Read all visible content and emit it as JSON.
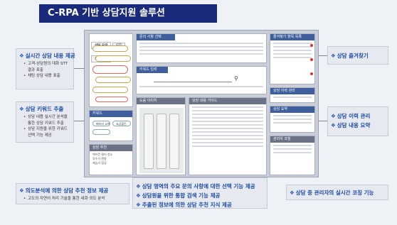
{
  "title": "C-RPA 기반 상담지원 솔루션",
  "callouts": {
    "realtime": {
      "head": "실시간 상담 내용 제공",
      "items": [
        "고객-상담원의 대화 STT 결과 표출",
        "채팅 상담 내용 표출"
      ]
    },
    "keyword": {
      "head": "상담 키워드 추출",
      "items": [
        "상담 내용 실시간 분석을 통한 상담 키워드 추출",
        "상담 지원을 위한 키워드 선택 기능 제공"
      ]
    },
    "intent": {
      "head": "의도분석에 의한 상담 추천 정보 제공",
      "items": [
        "고도의 자연어 처리 기술을 통한 내화 의도 분석"
      ]
    },
    "center": {
      "items": [
        "상담 영역의 주요 문의 사항에 대한 선택 기능 제공",
        "상담원을 위한 통합 검색 기능 제공",
        "추출된 정보에 의한 상담 추천 지식 제공"
      ]
    },
    "coaching": {
      "head": "상담 중 관리자의 실시간 코칭 기능"
    },
    "favorites": {
      "head": "상담 즐겨찾기"
    },
    "memo": {
      "items": [
        "상담 이력 관리",
        "상담 내용 요약"
      ]
    }
  },
  "ui": {
    "tabs": [
      "상담 요약",
      "STT",
      "채팅 상담"
    ],
    "search_label": "키워드 입력",
    "image_tab": "도움 이미지",
    "guide_tab": "상담 내용 가이드",
    "keyword_panel": "키워드",
    "keywords": [
      "배터리 교체",
      "요금할인"
    ],
    "recommend_panel": "상담 추천",
    "recommend_list": [
      "에어컨 필터 청소",
      "정수기 렌탈",
      "제습기 점검"
    ],
    "right_panels": [
      "즐겨찾기 항목 목록",
      "상담 이력 관리",
      "상담 요약",
      "관리자 코칭"
    ],
    "top_tab": "문의 사항 선택"
  },
  "colors": {
    "title_bg": "#1a2a7a",
    "accent": "#1c4aa0",
    "callout_bg": "#e6e9f0"
  }
}
